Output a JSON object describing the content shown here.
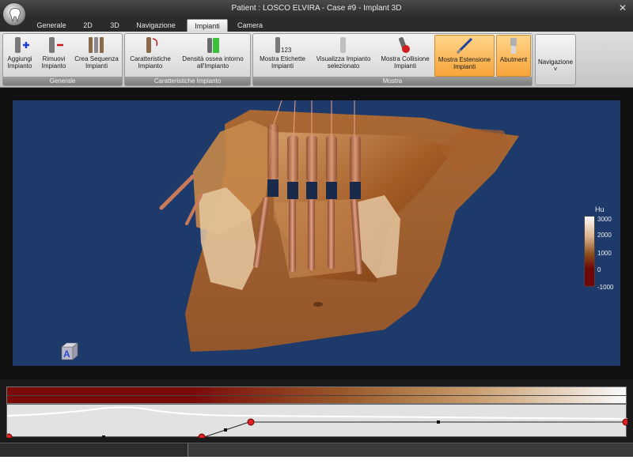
{
  "window": {
    "title": "Patient : LOSCO ELVIRA - Case #9 - Implant 3D",
    "close_glyph": "✕"
  },
  "tabs": [
    {
      "label": "Generale",
      "active": false
    },
    {
      "label": "2D",
      "active": false
    },
    {
      "label": "3D",
      "active": false
    },
    {
      "label": "Navigazione",
      "active": false
    },
    {
      "label": "Impianti",
      "active": true
    },
    {
      "label": "Camera",
      "active": false
    }
  ],
  "ribbon": {
    "groups": [
      {
        "label": "Generale",
        "buttons": [
          {
            "label": "Aggiungi\nImpianto",
            "icon": "add-implant-icon"
          },
          {
            "label": "Rimuovi\nImpianto",
            "icon": "remove-implant-icon"
          },
          {
            "label": "Crea Sequenza\nImpianti",
            "icon": "sequence-icon"
          }
        ]
      },
      {
        "label": "Caratteristiche Impianto",
        "buttons": [
          {
            "label": "Caratteristiche\nImpianto",
            "icon": "implant-properties-icon"
          },
          {
            "label": "Densità ossea intorno\nall'Impianto",
            "icon": "bone-density-icon"
          }
        ]
      },
      {
        "label": "Mostra",
        "buttons": [
          {
            "label": "Mostra Etichette\nImpianti",
            "icon": "labels-icon"
          },
          {
            "label": "Visualizza Impianto\nselezionato",
            "icon": "view-selected-icon"
          },
          {
            "label": "Mostra Collisione\nImpianti",
            "icon": "collision-icon"
          },
          {
            "label": "Mostra Estensione\nImpianti",
            "icon": "extension-icon",
            "highlighted": true
          },
          {
            "label": "Abutment",
            "icon": "abutment-icon",
            "highlighted": true
          }
        ]
      }
    ],
    "nav_button": {
      "label": "Navigazione",
      "caret": "˅"
    },
    "icon_text": {
      "labels_number": "123"
    }
  },
  "viewport": {
    "orientation_cube_letter": "A",
    "background": "#1d3a6b"
  },
  "hu_scale": {
    "title": "Hu",
    "ticks": [
      "3000",
      "2000",
      "1000",
      "0",
      "-1000"
    ]
  },
  "transfer_function": {
    "colors": [
      "#7a0a0a",
      "#9a5a2a",
      "#c89a6a",
      "#fafafa"
    ]
  },
  "colors": {
    "highlight": "#f7a43a",
    "implant": "#b8735a"
  }
}
